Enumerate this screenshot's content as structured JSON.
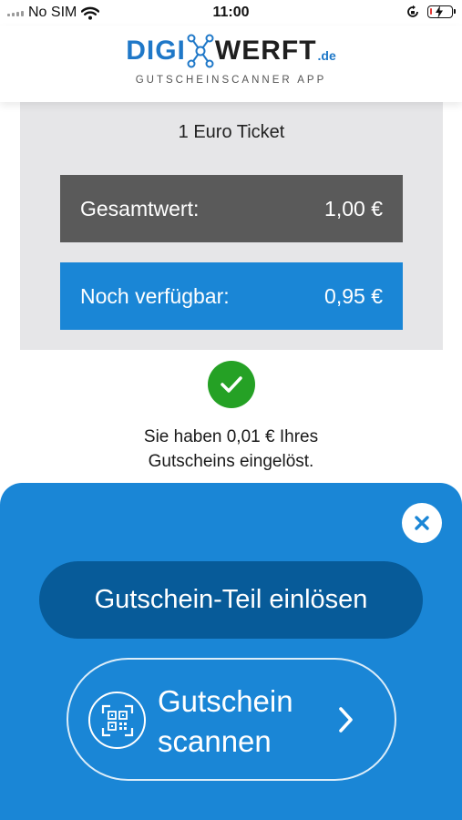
{
  "status_bar": {
    "carrier": "No SIM",
    "time": "11:00"
  },
  "header": {
    "logo_part1": "DIGI",
    "logo_part2": "WERFT",
    "logo_suffix": ".de",
    "tagline": "GUTSCHEINSCANNER APP"
  },
  "voucher": {
    "title": "1 Euro Ticket",
    "total_label": "Gesamtwert:",
    "total_value": "1,00 €",
    "available_label": "Noch verfügbar:",
    "available_value": "0,95 €"
  },
  "success": {
    "line1": "Sie haben 0,01 € Ihres",
    "line2": "Gutscheins eingelöst."
  },
  "actions": {
    "redeem_label": "Gutschein-Teil einlösen",
    "scan_label_line1": "Gutschein",
    "scan_label_line2": "scannen"
  },
  "colors": {
    "brand_blue": "#1a86d6",
    "dark_blue": "#075b99",
    "gray_row": "#5a5a5a",
    "success_green": "#25a125",
    "battery_low": "#e53935"
  },
  "icons": {
    "signal": "signal-bars-icon",
    "wifi": "wifi-icon",
    "rotation_lock": "rotation-lock-icon",
    "battery": "battery-charging-icon",
    "logo_node": "molecule-icon",
    "check": "checkmark-icon",
    "close": "close-icon",
    "qr": "qr-code-icon",
    "chevron": "chevron-right-icon"
  },
  "battery_level": 0.1
}
